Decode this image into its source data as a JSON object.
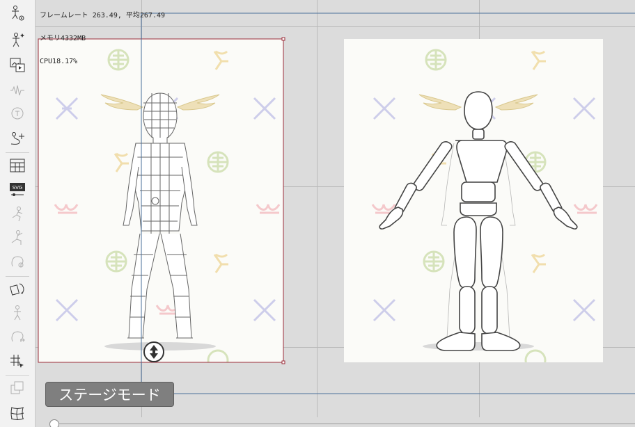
{
  "stats": {
    "frame_line": "フレームレート 263.49, 平均267.49",
    "memory": "メモリ4332MB",
    "cpu": "CPU18.17%"
  },
  "mode_button": {
    "label": "ステージモード"
  },
  "toolbar": {
    "tools": [
      {
        "icon": "character-settings-icon",
        "enabled": true
      },
      {
        "icon": "character-effect-icon",
        "enabled": true
      },
      {
        "icon": "image-play-icon",
        "enabled": true
      },
      {
        "icon": "audio-wave-icon",
        "enabled": false
      },
      {
        "icon": "text-bubble-icon",
        "enabled": false
      },
      {
        "icon": "path-add-icon",
        "enabled": true
      },
      {
        "icon": "grid-panel-icon",
        "enabled": true
      },
      {
        "icon": "svg-export-icon",
        "enabled": true
      },
      {
        "icon": "run-pose-icon",
        "enabled": false
      },
      {
        "icon": "action-icon",
        "enabled": false
      },
      {
        "icon": "head-face-icon",
        "enabled": false
      },
      {
        "icon": "rotate-object-icon",
        "enabled": true
      },
      {
        "icon": "figure-icon",
        "enabled": false
      },
      {
        "icon": "head-arrow-icon",
        "enabled": false
      },
      {
        "icon": "grid-select-icon",
        "enabled": true
      },
      {
        "icon": "layers-copy-icon",
        "enabled": false
      },
      {
        "icon": "mesh-warp-icon",
        "enabled": true
      }
    ]
  },
  "colors": {
    "selection_frame": "#9b2c3a",
    "guide_line": "#4a6f9a",
    "background_tile": "#fbfbf8"
  }
}
